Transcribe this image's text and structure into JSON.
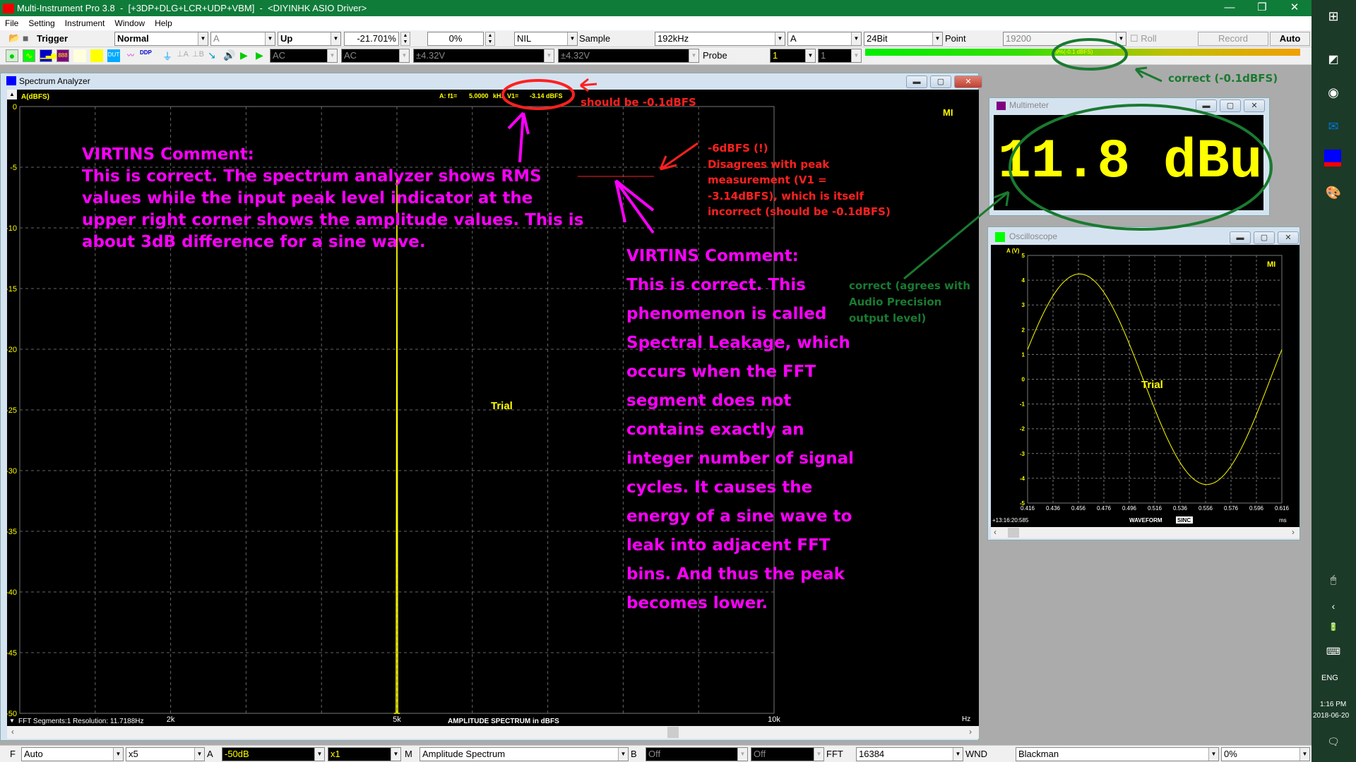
{
  "window": {
    "title": "Multi-Instrument Pro 3.8  -  [+3DP+DLG+LCR+UDP+VBM]  -  <DIYINHK ASIO Driver>",
    "controls": {
      "minimize": "—",
      "restore": "❐",
      "close": "✕"
    }
  },
  "menu": [
    "File",
    "Setting",
    "Instrument",
    "Window",
    "Help"
  ],
  "toolbar1": {
    "trigger_label": "Trigger",
    "trigger_mode": "Normal",
    "trigger_channel": "A",
    "trigger_edge": "Up",
    "trigger_level": "-21.701%",
    "trigger_delay": "0%",
    "trigger_source": "NIL",
    "sample_label": "Sample",
    "sample_rate": "192kHz",
    "channel": "A",
    "bit_depth": "24Bit",
    "point_label": "Point",
    "points": "19200",
    "roll_label": "Roll",
    "record_label": "Record",
    "auto_label": "Auto"
  },
  "toolbar2": {
    "icons": [
      "oscilloscope-icon",
      "spectrum-analyzer-icon",
      "multimeter-icon",
      "signal-generator-icon",
      "dds-icon",
      "device-test-icon",
      "data-logger-icon",
      "ddp-icon",
      "calibration-icon",
      "channel-a-ground-icon",
      "channel-b-ground-icon",
      "probe-icon",
      "speaker-icon",
      "play-icon",
      "play-once-icon"
    ],
    "coupling_a": "AC",
    "coupling_b": "AC",
    "range_a": "±4.32V",
    "range_b": "±4.32V",
    "probe_label": "Probe",
    "probe_a": "1",
    "probe_b": "1",
    "input_level_percent": 99,
    "input_level_text": "99%(-0.1 dBFS)"
  },
  "spectrum_window": {
    "title": "Spectrum Analyzer",
    "y_axis_label": "A(dBFS)",
    "readout": {
      "prefix": "A: f1=",
      "f1": "5.0000",
      "f1_unit": "kHz",
      "v1_label": "V1=",
      "v1": "-3.14 dBFS"
    },
    "logo": "MI",
    "watermark": "Trial",
    "footer_left": "FFT Segments:1    Resolution: 11.7188Hz",
    "footer_center": "AMPLITUDE SPECTRUM in dBFS",
    "x_unit": "Hz"
  },
  "chart_data": [
    {
      "type": "line",
      "title": "AMPLITUDE SPECTRUM in dBFS",
      "xlabel": "Hz",
      "ylabel": "A(dBFS)",
      "xlim": [
        0,
        10000
      ],
      "ylim": [
        -50,
        0
      ],
      "x_ticks": [
        {
          "value": 2000,
          "label": "2k"
        },
        {
          "value": 5000,
          "label": "5k"
        },
        {
          "value": 10000,
          "label": "10k"
        }
      ],
      "y_ticks": [
        0,
        -5,
        -10,
        -15,
        -20,
        -25,
        -30,
        -35,
        -40,
        -45,
        -50
      ],
      "grid": true,
      "series": [
        {
          "name": "A",
          "color": "#ffff00",
          "x": [
            4960,
            4990,
            5000,
            5010,
            5040
          ],
          "y": [
            -50,
            -50,
            -6,
            -50,
            -50
          ]
        }
      ]
    },
    {
      "type": "line",
      "title": "WAVEFORM",
      "xlabel": "ms",
      "ylabel": "A (V)",
      "xlim": [
        0.416,
        0.616
      ],
      "ylim": [
        -5,
        5
      ],
      "x_ticks": [
        "0.416",
        "0.436",
        "0.456",
        "0.476",
        "0.496",
        "0.516",
        "0.536",
        "0.556",
        "0.576",
        "0.596",
        "0.616"
      ],
      "y_ticks": [
        5,
        4,
        3,
        2,
        1,
        0,
        -1,
        -2,
        -3,
        -4,
        -5
      ],
      "grid": true,
      "series": [
        {
          "name": "A",
          "color": "#ffff00",
          "amplitude_v": 4.25,
          "frequency_hz": 5000,
          "start_value_v": 1.2,
          "description": "sine wave"
        }
      ]
    }
  ],
  "multimeter": {
    "title": "Multimeter",
    "reading": "11.8 dBu"
  },
  "oscilloscope": {
    "title": "Oscilloscope",
    "y_axis_label": "A (V)",
    "logo": "MI",
    "watermark": "Trial",
    "timestamp": "+13:16:20:585",
    "footer": "WAVEFORM",
    "badge": "SINC",
    "x_unit": "ms"
  },
  "bottombar": {
    "f_label": "F",
    "freq_range": "Auto",
    "zoom": "x5",
    "a_label": "A",
    "a_range": "-50dB",
    "a_scale": "x1",
    "m_label": "M",
    "mode": "Amplitude Spectrum",
    "b_label": "B",
    "b_range": "Off",
    "b_scale": "Off",
    "fft_label": "FFT",
    "fft_size": "16384",
    "wnd_label": "WND",
    "window_fn": "Blackman",
    "overlap": "0%"
  },
  "taskbar": {
    "lang": "ENG",
    "time": "1:16 PM",
    "date": "2018-06-20"
  },
  "annotations": {
    "v1_note": "should be -0.1dBFS",
    "level_note": "correct (-0.1dBFS)",
    "peak_note": [
      "-6dBFS (!)",
      "Disagrees with peak",
      "measurement (V1 =",
      "-3.14dBFS), which is itself",
      "incorrect (should be -0.1dBFS)"
    ],
    "multimeter_note": [
      "correct (agrees with",
      "Audio Precision",
      "output level)"
    ],
    "virtins1": [
      "VIRTINS Comment:",
      "This is correct. The spectrum analyzer shows RMS",
      "values while the input peak level indicator at the",
      "upper right corner shows the amplitude values. This is",
      "about 3dB difference for a sine wave."
    ],
    "virtins2": [
      "VIRTINS Comment:",
      "This is correct. This",
      "phenomenon is called",
      "Spectral Leakage, which",
      "occurs when the FFT",
      "segment does not",
      "contains exactly an",
      "integer number of signal",
      "cycles.  It causes the",
      "energy of a sine wave to",
      "leak into adjacent FFT",
      "bins. And thus the peak",
      "becomes lower."
    ]
  }
}
